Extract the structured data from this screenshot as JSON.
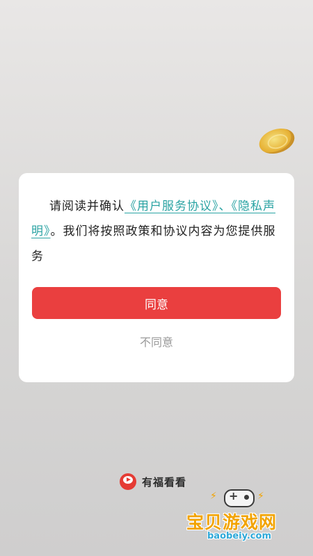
{
  "dialog": {
    "text_prefix": "请阅读并确认",
    "user_agreement_link": "《用户服务协议》、",
    "privacy_link": "《隐私声明》",
    "text_suffix": "。我们将按照政策和协议内容为您提供服务",
    "agree_label": "同意",
    "disagree_label": "不同意"
  },
  "brand": {
    "name": "有福看看",
    "logo_icon": "play-badge-icon"
  },
  "watermark": {
    "title": "宝贝游戏网",
    "url": "baobeiy.com"
  },
  "colors": {
    "accent_red": "#ea3f3f",
    "link_teal": "#2aa3a3",
    "secondary_text": "#999999"
  }
}
